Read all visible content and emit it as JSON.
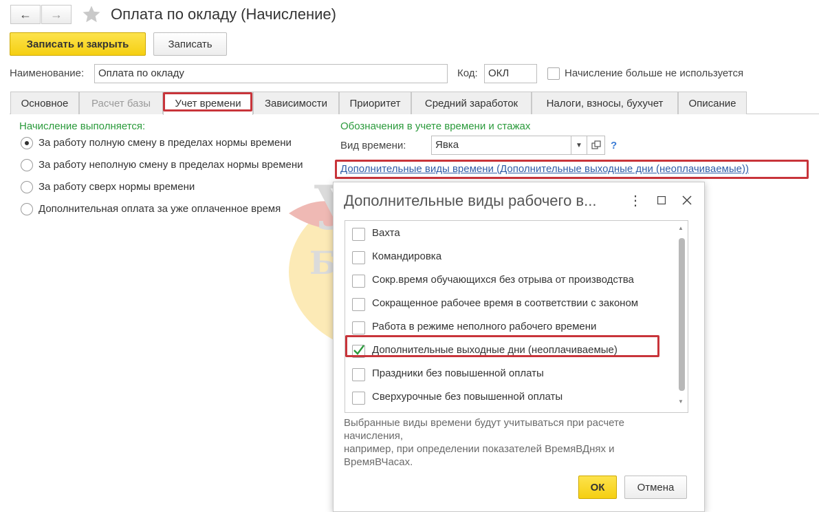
{
  "window": {
    "title": "Оплата по окладу (Начисление)"
  },
  "toolbar": {
    "save_close_label": "Записать и закрыть",
    "save_label": "Записать"
  },
  "form": {
    "name_label": "Наименование:",
    "name_value": "Оплата по окладу",
    "code_label": "Код:",
    "code_value": "ОКЛ",
    "unused_label": "Начисление больше не используется"
  },
  "tabs": [
    {
      "label": "Основное",
      "state": "normal"
    },
    {
      "label": "Расчет базы",
      "state": "disabled"
    },
    {
      "label": "Учет времени",
      "state": "active"
    },
    {
      "label": "Зависимости",
      "state": "normal"
    },
    {
      "label": "Приоритет",
      "state": "normal"
    },
    {
      "label": "Средний заработок",
      "state": "normal"
    },
    {
      "label": "Налоги, взносы, бухучет",
      "state": "normal"
    },
    {
      "label": "Описание",
      "state": "normal"
    }
  ],
  "left_section": {
    "title": "Начисление выполняется:",
    "options": [
      {
        "label": "За работу полную смену в пределах нормы времени",
        "selected": true
      },
      {
        "label": "За работу неполную смену в пределах нормы времени",
        "selected": false
      },
      {
        "label": "За работу сверх нормы времени",
        "selected": false
      },
      {
        "label": "Дополнительная оплата за уже оплаченное время",
        "selected": false
      }
    ]
  },
  "right_section": {
    "title": "Обозначения в учете времени и стажах",
    "time_kind_label": "Вид времени:",
    "time_kind_value": "Явка",
    "help": "?",
    "extra_link": "Дополнительные виды времени (Дополнительные выходные дни (неоплачиваемые))"
  },
  "watermark": {
    "line1": "УЧЕТ",
    "line2": "БЕЗ ЗАБОТ"
  },
  "dialog": {
    "title": "Дополнительные виды рабочего в...",
    "items": [
      {
        "label": "Вахта",
        "checked": false
      },
      {
        "label": "Командировка",
        "checked": false
      },
      {
        "label": "Сокр.время обучающихся без отрыва от производства",
        "checked": false
      },
      {
        "label": "Сокращенное рабочее время в соответствии с законом",
        "checked": false
      },
      {
        "label": "Работа в режиме неполного рабочего времени",
        "checked": false
      },
      {
        "label": "Дополнительные выходные дни (неоплачиваемые)",
        "checked": true
      },
      {
        "label": "Праздники без повышенной оплаты",
        "checked": false
      },
      {
        "label": "Сверхурочные без повышенной оплаты",
        "checked": false
      }
    ],
    "note_line1": "Выбранные виды времени будут учитываться при расчете",
    "note_line2": "начисления,",
    "note_line3": "например, при определении показателей ВремяВДнях и",
    "note_line4": "ВремяВЧасах.",
    "ok_label": "ОК",
    "cancel_label": "Отмена"
  },
  "colors": {
    "accent_yellow": "#f5cf12",
    "highlight_red": "#c8343a",
    "section_green": "#2a9a3b",
    "link_blue": "#2f5da8"
  }
}
